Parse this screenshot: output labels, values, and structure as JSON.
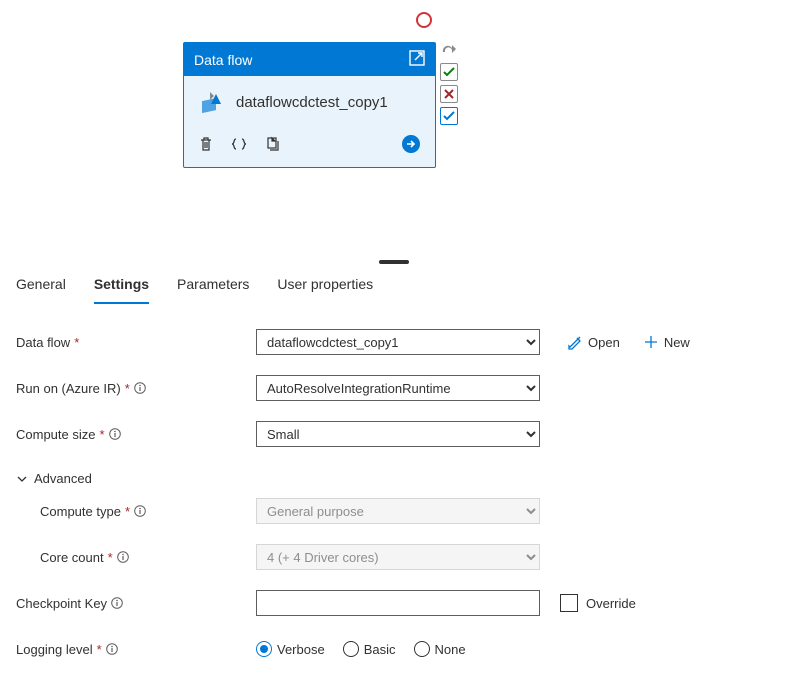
{
  "canvas": {
    "card_title": "Data flow",
    "card_name": "dataflowcdctest_copy1"
  },
  "tabs": [
    "General",
    "Settings",
    "Parameters",
    "User properties"
  ],
  "active_tab": "Settings",
  "form": {
    "dataflow": {
      "label": "Data flow",
      "value": "dataflowcdctest_copy1"
    },
    "open": "Open",
    "new": "New",
    "runon": {
      "label": "Run on (Azure IR)",
      "value": "AutoResolveIntegrationRuntime"
    },
    "compute_size": {
      "label": "Compute size",
      "value": "Small"
    },
    "advanced": "Advanced",
    "compute_type": {
      "label": "Compute type",
      "value": "General purpose"
    },
    "core_count": {
      "label": "Core count",
      "value": "4 (+ 4 Driver cores)"
    },
    "checkpoint": {
      "label": "Checkpoint Key",
      "value": "",
      "override": "Override"
    },
    "logging": {
      "label": "Logging level",
      "options": [
        "Verbose",
        "Basic",
        "None"
      ],
      "selected": "Verbose"
    }
  }
}
